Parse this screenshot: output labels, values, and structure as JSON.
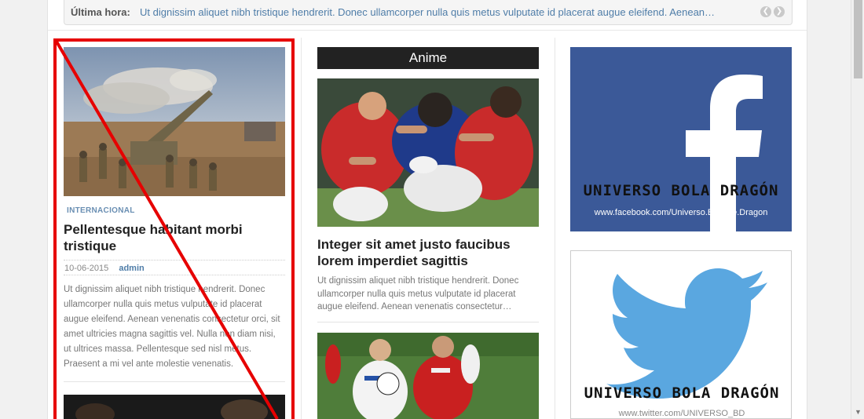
{
  "ticker": {
    "label": "Última hora:",
    "text": "Ut dignissim aliquet nibh tristique hendrerit. Donec ullamcorper nulla quis metus vulputate id placerat augue eleifend. Aenean…",
    "prev_icon": "chevron-left-icon",
    "next_icon": "chevron-right-icon"
  },
  "post1": {
    "category": "INTERNACIONAL",
    "title": "Pellentesque habitant morbi tristique",
    "date": "10-06-2015",
    "author": "admin",
    "excerpt": "Ut dignissim aliquet nibh tristique hendrerit. Donec ullamcorper nulla quis metus vulputate id placerat augue eleifend. Aenean venenatis consectetur orci, sit amet ultricies magna sagittis vel. Nulla non diam nisi, ut ultrices massa. Pellentesque sed nisl metus. Praesent a mi vel ante molestie venenatis."
  },
  "section2": {
    "heading": "Anime",
    "title": "Integer sit amet justo faucibus lorem imperdiet sagittis",
    "excerpt": "Ut dignissim aliquet nibh tristique hendrerit. Donec ullamcorper nulla quis metus vulputate id placerat augue eleifend. Aenean venenatis consectetur…"
  },
  "facebook": {
    "brand": "UNIVERSO BOLA DRAGÓN",
    "url": "www.facebook.com/Universo.Bola.de.Dragon",
    "color": "#3b5998"
  },
  "twitter": {
    "brand": "UNIVERSO BOLA DRAGÓN",
    "url": "www.twitter.com/UNIVERSO_BD",
    "color": "#5aa7e0"
  },
  "annotation": {
    "color": "#e60000"
  }
}
